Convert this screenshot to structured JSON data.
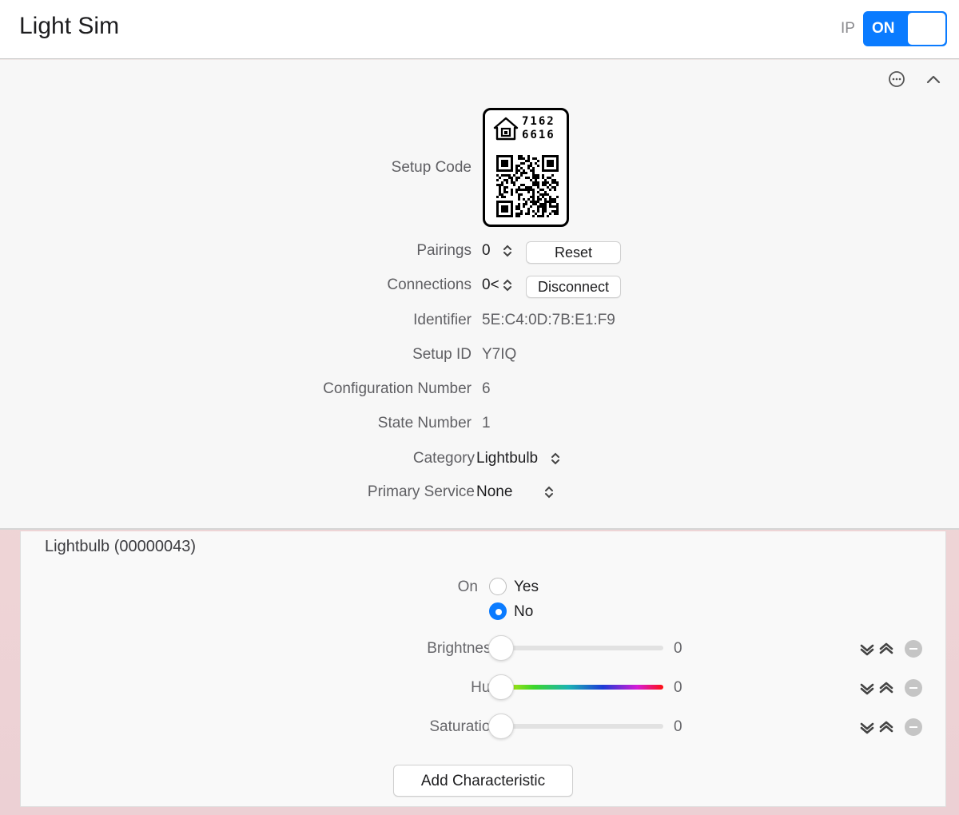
{
  "header": {
    "title": "Light Sim",
    "ip_label": "IP",
    "toggle_label": "ON",
    "accent": "#0a7bff"
  },
  "accessory": {
    "icons": {
      "more": "ellipsis-circle-icon",
      "collapse": "chevron-up-icon"
    },
    "setup_code": {
      "label": "Setup Code",
      "code_line1": "7162",
      "code_line2": "6616",
      "icon": "home-icon"
    },
    "pairings": {
      "label": "Pairings",
      "value": "0",
      "button": "Reset"
    },
    "connections": {
      "label": "Connections",
      "value": "0",
      "value_suffix": "<",
      "button": "Disconnect"
    },
    "identifier": {
      "label": "Identifier",
      "value": "5E:C4:0D:7B:E1:F9"
    },
    "setup_id": {
      "label": "Setup ID",
      "value": "Y7IQ"
    },
    "configuration_number": {
      "label": "Configuration Number",
      "value": "6"
    },
    "state_number": {
      "label": "State Number",
      "value": "1"
    },
    "category": {
      "label": "Category",
      "value": "Lightbulb"
    },
    "primary_service": {
      "label": "Primary Service",
      "value": "None"
    }
  },
  "service": {
    "title": "Lightbulb (00000043)",
    "on": {
      "label": "On",
      "options": [
        "Yes",
        "No"
      ],
      "selected": "No"
    },
    "characteristics": [
      {
        "label": "Brightness",
        "value": "0",
        "track": "plain"
      },
      {
        "label": "Hue",
        "value": "0",
        "track": "hue"
      },
      {
        "label": "Saturation",
        "value": "0",
        "track": "plain"
      }
    ],
    "add_button": "Add Characteristic"
  }
}
